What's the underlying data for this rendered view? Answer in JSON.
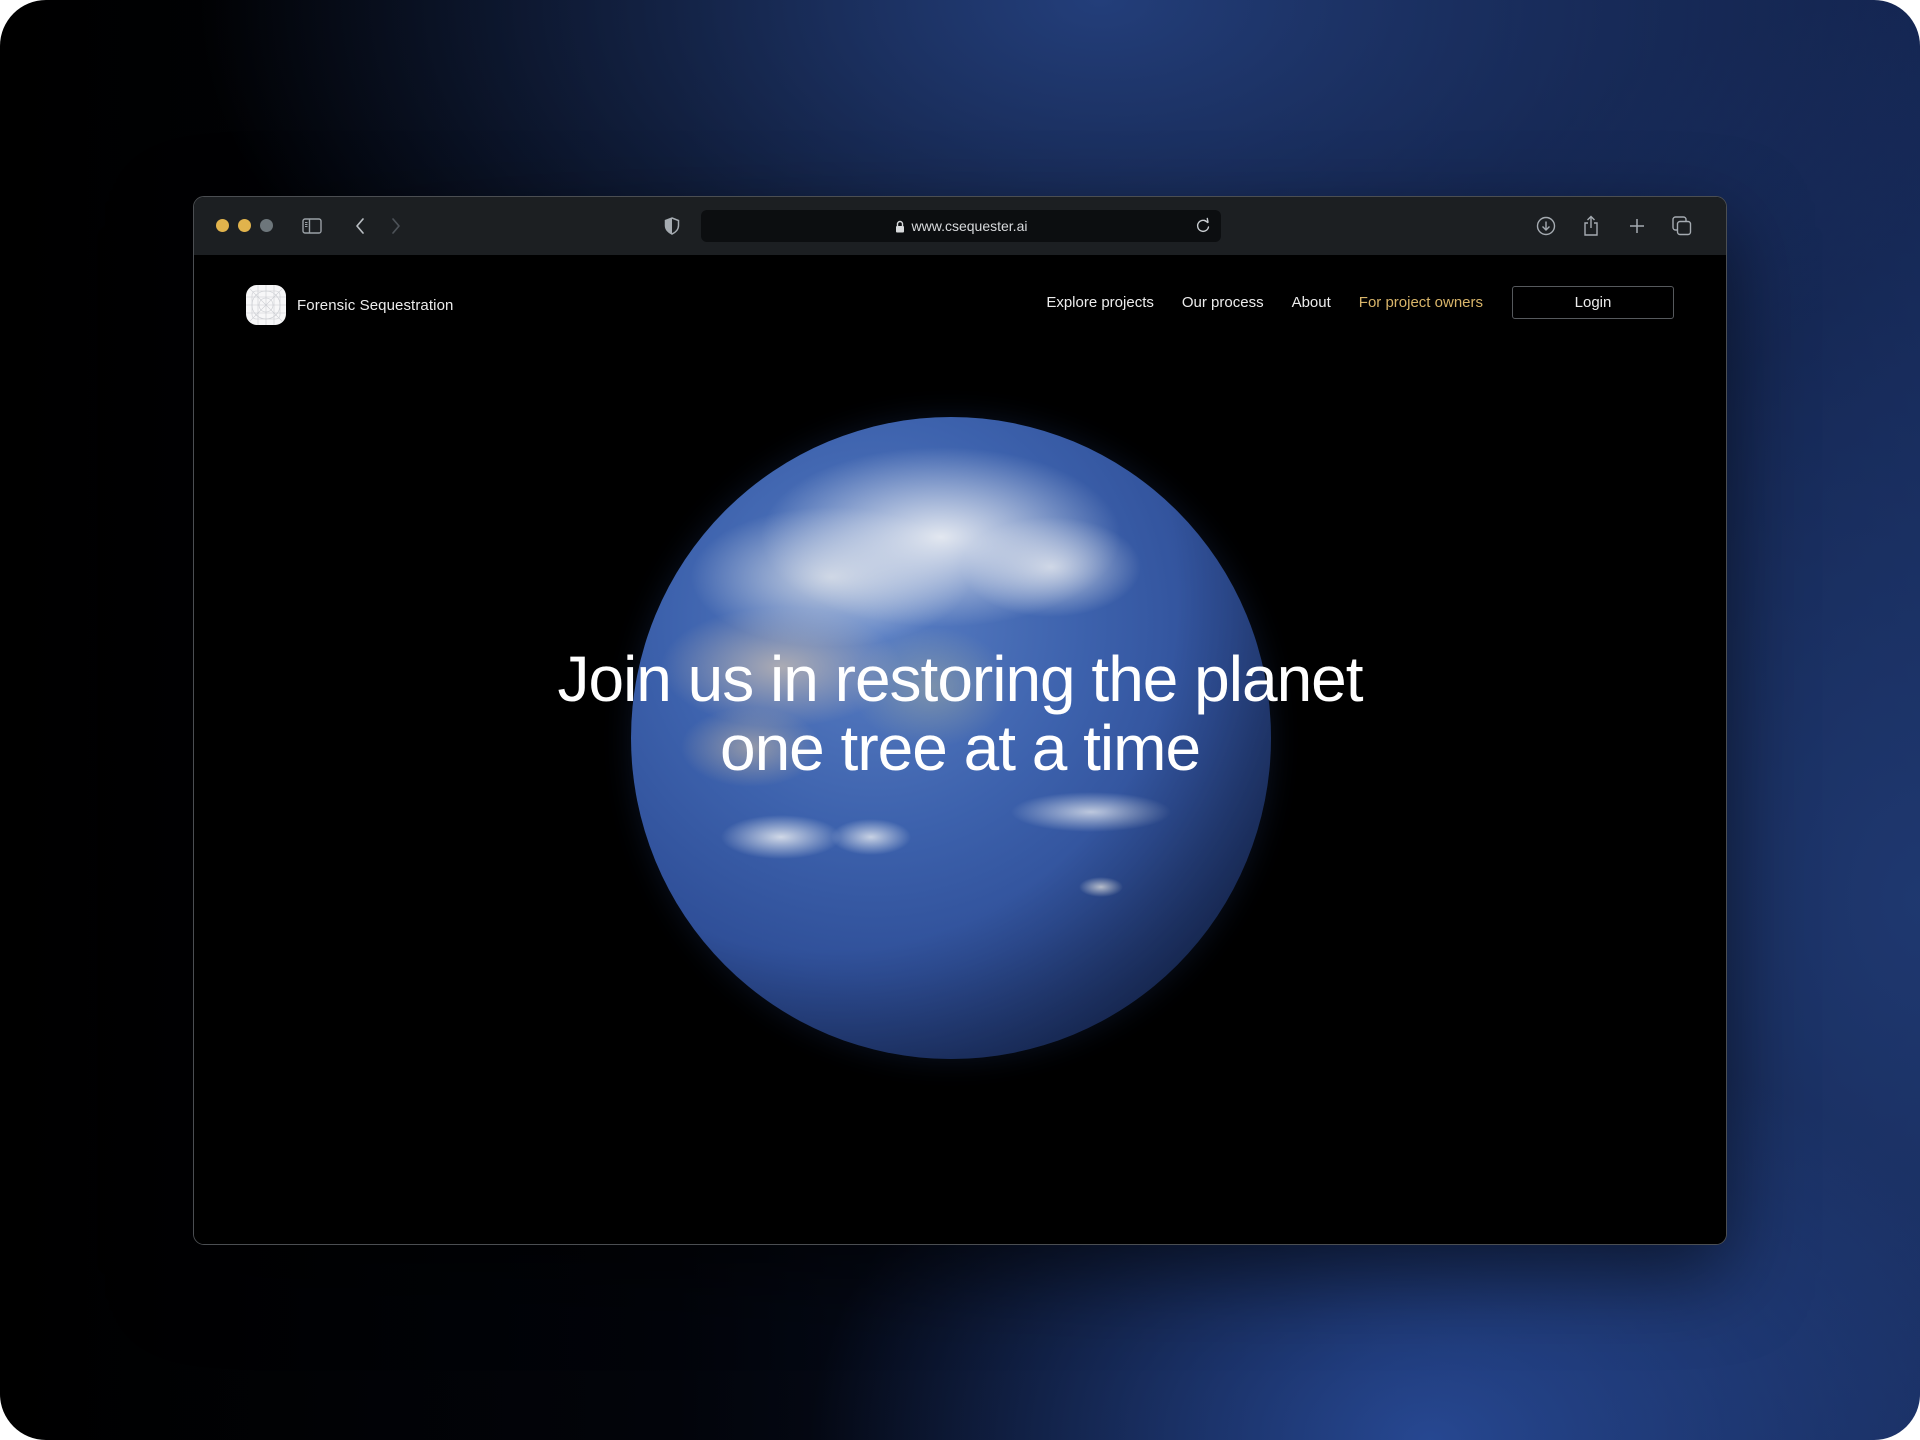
{
  "browser": {
    "url": "www.csequester.ai",
    "traffic_lights": [
      "close",
      "minimize",
      "zoom"
    ],
    "toolbar_icons": {
      "left": [
        "sidebar-icon",
        "back-chevron-icon",
        "forward-chevron-icon"
      ],
      "privacy": "shield-icon",
      "address_left": "lock-icon",
      "address_right": "reload-icon",
      "right": [
        "download-icon",
        "share-icon",
        "new-tab-icon",
        "tabs-overview-icon"
      ]
    }
  },
  "site": {
    "brand_name": "Forensic Sequestration",
    "nav": [
      {
        "label": "Explore projects"
      },
      {
        "label": "Our process"
      },
      {
        "label": "About"
      },
      {
        "label": "For project owners",
        "highlight": true
      }
    ],
    "login_label": "Login",
    "hero": {
      "line1": "Join us in restoring the planet",
      "line2": "one tree at a time"
    }
  },
  "colors": {
    "accent": "#d9b56a",
    "traffic_yellow": "#e1b34c",
    "traffic_gray": "#6d767b",
    "toolbar_bg": "#1c1f22",
    "page_bg": "#000000",
    "backdrop_blue": "#213a70"
  }
}
